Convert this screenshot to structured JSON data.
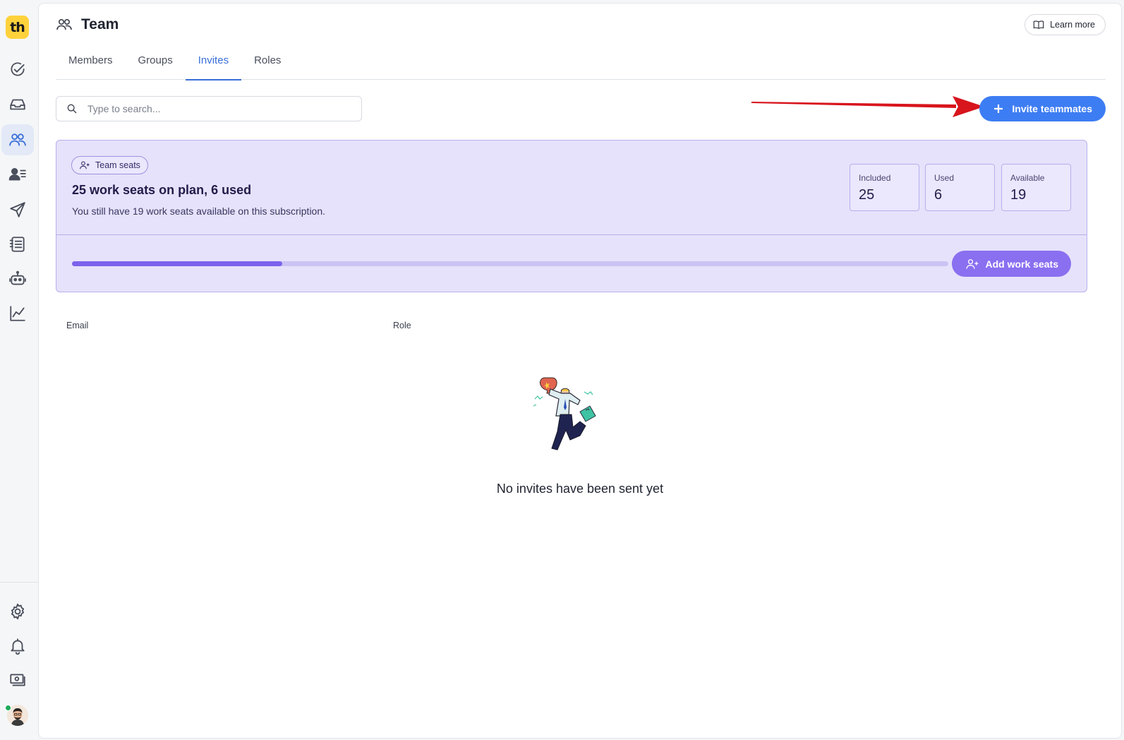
{
  "app": {
    "logo_text": "th"
  },
  "rail": {
    "items": [
      {
        "icon": "check-circle-icon"
      },
      {
        "icon": "inbox-icon"
      },
      {
        "icon": "team-icon",
        "active": true
      },
      {
        "icon": "contacts-icon"
      },
      {
        "icon": "send-icon"
      },
      {
        "icon": "list-icon"
      },
      {
        "icon": "bot-icon"
      },
      {
        "icon": "analytics-icon"
      }
    ],
    "bottom": [
      {
        "icon": "gear-icon"
      },
      {
        "icon": "bell-icon"
      },
      {
        "icon": "billing-icon"
      }
    ]
  },
  "header": {
    "title": "Team",
    "learn_more": "Learn more"
  },
  "tabs": [
    {
      "label": "Members"
    },
    {
      "label": "Groups"
    },
    {
      "label": "Invites",
      "active": true
    },
    {
      "label": "Roles"
    }
  ],
  "search": {
    "placeholder": "Type to search...",
    "value": ""
  },
  "invite_button": {
    "label": "Invite teammates"
  },
  "seats": {
    "badge": "Team seats",
    "title": "25 work seats on plan, 6 used",
    "subtitle": "You still have 19 work seats available on this subscription.",
    "stats": [
      {
        "label": "Included",
        "value": "25"
      },
      {
        "label": "Used",
        "value": "6"
      },
      {
        "label": "Available",
        "value": "19"
      }
    ],
    "progress_percent": 24,
    "add_button": "Add work seats"
  },
  "table": {
    "columns": [
      "Email",
      "Role"
    ]
  },
  "empty_state": {
    "message": "No invites have been sent yet"
  },
  "colors": {
    "accent": "#3d7df3",
    "active_tab": "#3a6fd8",
    "seats_bg": "#e6e2fb",
    "seats_button": "#8a6ff0",
    "progress_fill": "#7c62ec",
    "logo": "#ffd23c",
    "arrow": "#d8141c"
  }
}
